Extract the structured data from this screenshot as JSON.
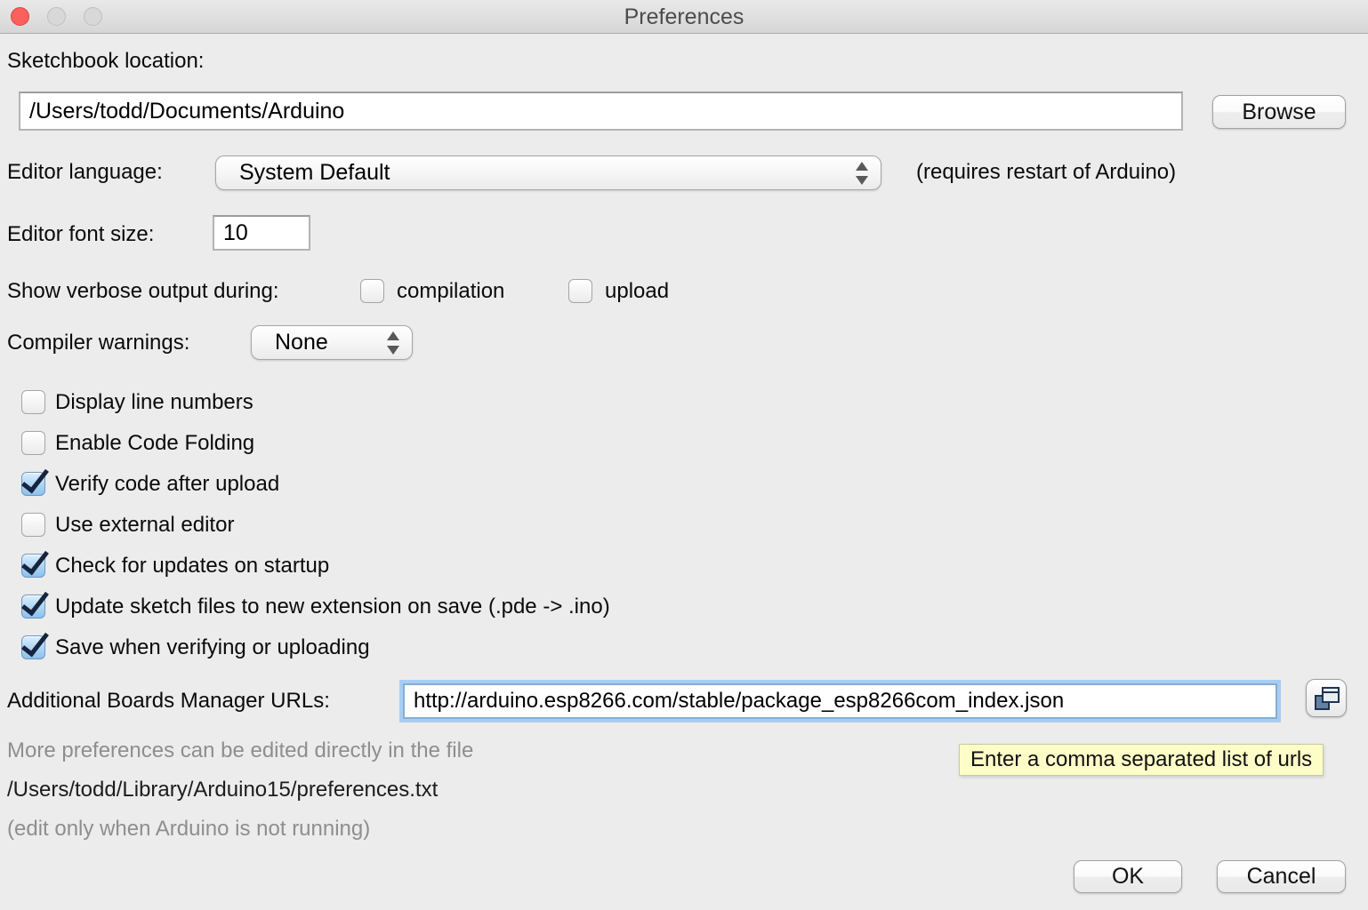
{
  "window": {
    "title": "Preferences"
  },
  "sketchbook": {
    "label": "Sketchbook location:",
    "value": "/Users/todd/Documents/Arduino",
    "browse_label": "Browse"
  },
  "editor_language": {
    "label": "Editor language:",
    "value": "System Default",
    "note": "(requires restart of Arduino)"
  },
  "editor_font_size": {
    "label": "Editor font size:",
    "value": "10"
  },
  "verbose": {
    "label": "Show verbose output during:",
    "options": [
      {
        "label": "compilation",
        "checked": false
      },
      {
        "label": "upload",
        "checked": false
      }
    ]
  },
  "compiler_warnings": {
    "label": "Compiler warnings:",
    "value": "None"
  },
  "checkboxes": [
    {
      "label": "Display line numbers",
      "checked": false
    },
    {
      "label": "Enable Code Folding",
      "checked": false
    },
    {
      "label": "Verify code after upload",
      "checked": true
    },
    {
      "label": "Use external editor",
      "checked": false
    },
    {
      "label": "Check for updates on startup",
      "checked": true
    },
    {
      "label": "Update sketch files to new extension on save (.pde -> .ino)",
      "checked": true
    },
    {
      "label": "Save when verifying or uploading",
      "checked": true
    }
  ],
  "boards_manager": {
    "label": "Additional Boards Manager URLs:",
    "value": "http://arduino.esp8266.com/stable/package_esp8266com_index.json",
    "tooltip": "Enter a comma separated list of urls",
    "icon": "overlapping-windows-icon"
  },
  "footer": {
    "line1": "More preferences can be edited directly in the file",
    "line2": "/Users/todd/Library/Arduino15/preferences.txt",
    "line3": "(edit only when Arduino is not running)"
  },
  "actions": {
    "ok": "OK",
    "cancel": "Cancel"
  },
  "colors": {
    "background": "#ececec",
    "focus_ring": "#a9cdf1",
    "checkbox_checked": "#8cc1ee",
    "checkmark": "#16243d",
    "tooltip_bg": "#fdfdc8",
    "muted_text": "#8e8e8e",
    "close_button_red": "#fb615c"
  }
}
